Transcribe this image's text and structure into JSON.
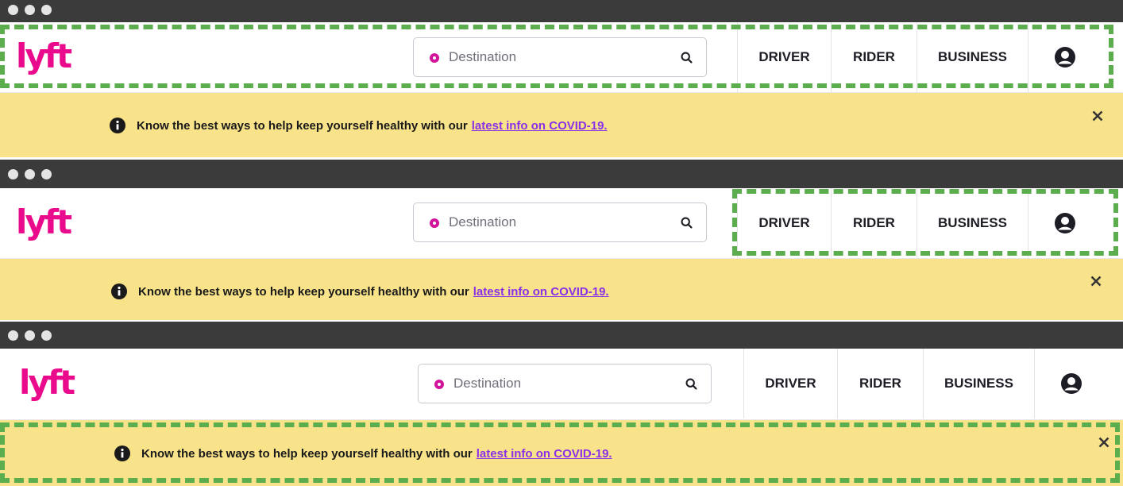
{
  "panels": [
    {
      "logo": "lyft",
      "search_placeholder": "Destination",
      "nav": {
        "driver": "DRIVER",
        "rider": "RIDER",
        "business": "BUSINESS"
      },
      "banner": {
        "text": "Know the best ways to help keep yourself healthy with our",
        "link": "latest info on COVID-19."
      },
      "highlight": "navbar-left"
    },
    {
      "logo": "lyft",
      "search_placeholder": "Destination",
      "nav": {
        "driver": "DRIVER",
        "rider": "RIDER",
        "business": "BUSINESS"
      },
      "banner": {
        "text": "Know the best ways to help keep yourself healthy with our",
        "link": "latest info on COVID-19."
      },
      "highlight": "nav-links"
    },
    {
      "logo": "lyft",
      "search_placeholder": "Destination",
      "nav": {
        "driver": "DRIVER",
        "rider": "RIDER",
        "business": "BUSINESS"
      },
      "banner": {
        "text": "Know the best ways to help keep yourself healthy with our",
        "link": "latest info on COVID-19."
      },
      "highlight": "banner"
    }
  ],
  "colors": {
    "brand": "#ea0b8c",
    "banner_bg": "#f8e28a",
    "link": "#8a30e8",
    "highlight": "#5bad4e",
    "titlebar": "#3b3b3b"
  },
  "icons": [
    "search-icon",
    "location-pin-icon",
    "account-icon",
    "info-icon",
    "close-icon"
  ]
}
